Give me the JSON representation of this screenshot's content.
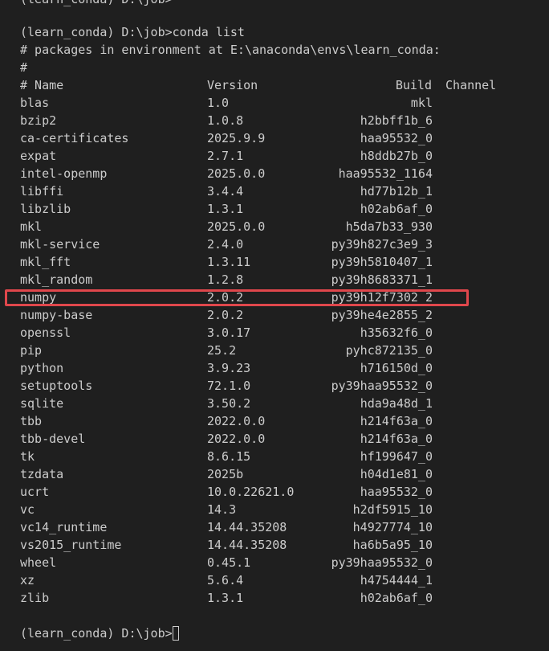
{
  "terminal": {
    "top_partial_line": "(learn_conda) D:\\job>",
    "prompt_line": "(learn_conda) D:\\job>conda list",
    "env_comment": "# packages in environment at E:\\anaconda\\envs\\learn_conda:",
    "hash_line": "#",
    "header": {
      "name": "# Name",
      "version": "Version",
      "build": "Build",
      "channel": "Channel"
    },
    "packages": [
      {
        "name": "blas",
        "version": "1.0",
        "build": "mkl"
      },
      {
        "name": "bzip2",
        "version": "1.0.8",
        "build": "h2bbff1b_6"
      },
      {
        "name": "ca-certificates",
        "version": "2025.9.9",
        "build": "haa95532_0"
      },
      {
        "name": "expat",
        "version": "2.7.1",
        "build": "h8ddb27b_0"
      },
      {
        "name": "intel-openmp",
        "version": "2025.0.0",
        "build": "haa95532_1164"
      },
      {
        "name": "libffi",
        "version": "3.4.4",
        "build": "hd77b12b_1"
      },
      {
        "name": "libzlib",
        "version": "1.3.1",
        "build": "h02ab6af_0"
      },
      {
        "name": "mkl",
        "version": "2025.0.0",
        "build": "h5da7b33_930"
      },
      {
        "name": "mkl-service",
        "version": "2.4.0",
        "build": "py39h827c3e9_3"
      },
      {
        "name": "mkl_fft",
        "version": "1.3.11",
        "build": "py39h5810407_1"
      },
      {
        "name": "mkl_random",
        "version": "1.2.8",
        "build": "py39h8683371_1"
      },
      {
        "name": "numpy",
        "version": "2.0.2",
        "build": "py39h12f7302_2"
      },
      {
        "name": "numpy-base",
        "version": "2.0.2",
        "build": "py39he4e2855_2"
      },
      {
        "name": "openssl",
        "version": "3.0.17",
        "build": "h35632f6_0"
      },
      {
        "name": "pip",
        "version": "25.2",
        "build": "pyhc872135_0"
      },
      {
        "name": "python",
        "version": "3.9.23",
        "build": "h716150d_0"
      },
      {
        "name": "setuptools",
        "version": "72.1.0",
        "build": "py39haa95532_0"
      },
      {
        "name": "sqlite",
        "version": "3.50.2",
        "build": "hda9a48d_1"
      },
      {
        "name": "tbb",
        "version": "2022.0.0",
        "build": "h214f63a_0"
      },
      {
        "name": "tbb-devel",
        "version": "2022.0.0",
        "build": "h214f63a_0"
      },
      {
        "name": "tk",
        "version": "8.6.15",
        "build": "hf199647_0"
      },
      {
        "name": "tzdata",
        "version": "2025b",
        "build": "h04d1e81_0"
      },
      {
        "name": "ucrt",
        "version": "10.0.22621.0",
        "build": "haa95532_0"
      },
      {
        "name": "vc",
        "version": "14.3",
        "build": "h2df5915_10"
      },
      {
        "name": "vc14_runtime",
        "version": "14.44.35208",
        "build": "h4927774_10"
      },
      {
        "name": "vs2015_runtime",
        "version": "14.44.35208",
        "build": "ha6b5a95_10"
      },
      {
        "name": "wheel",
        "version": "0.45.1",
        "build": "py39haa95532_0"
      },
      {
        "name": "xz",
        "version": "5.6.4",
        "build": "h4754444_1"
      },
      {
        "name": "zlib",
        "version": "1.3.1",
        "build": "h02ab6af_0"
      }
    ],
    "final_prompt": "(learn_conda) D:\\job>",
    "highlighted_package": "numpy",
    "colors": {
      "background": "#1f1f1f",
      "text": "#cccccc",
      "highlight": "#e0474c"
    }
  }
}
